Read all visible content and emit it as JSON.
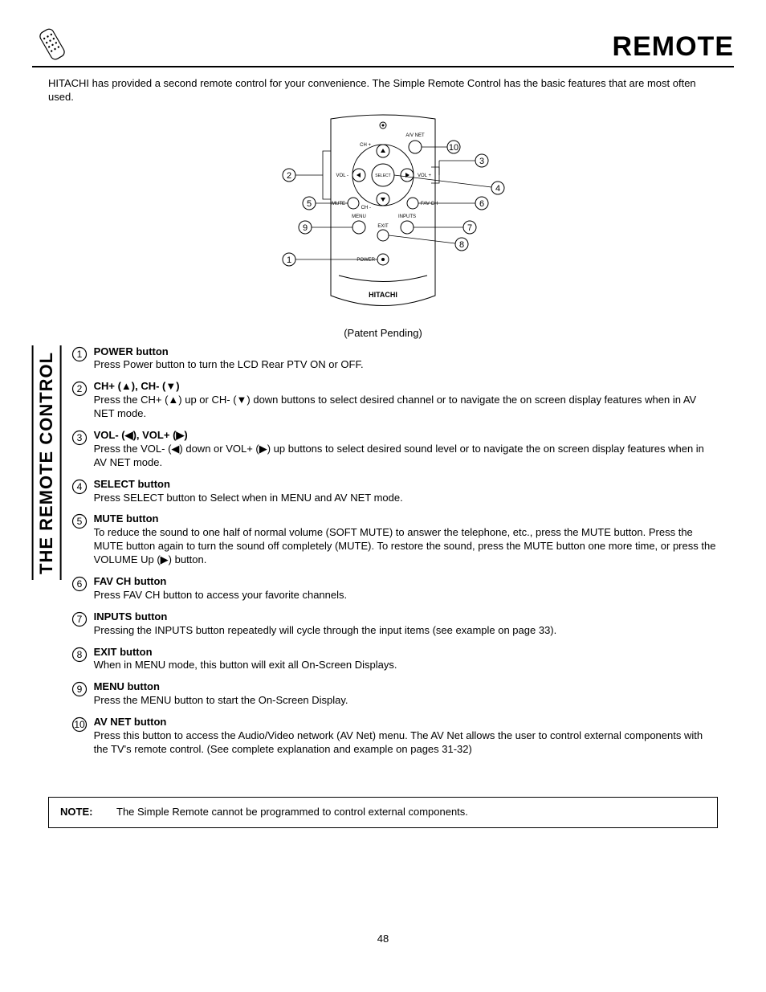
{
  "header": {
    "title": "REMOTE"
  },
  "intro": "HITACHI has provided a second remote control for your convenience.  The Simple Remote Control has the basic features that are most often used.",
  "diagram": {
    "labels": {
      "av_net": "A/V NET",
      "ch_plus": "CH +",
      "ch_minus": "CH -",
      "vol_plus": "VOL +",
      "vol_minus": "VOL -",
      "select": "SELECT",
      "mute": "MUTE",
      "fav_ch": "FAV CH",
      "menu": "MENU",
      "inputs": "INPUTS",
      "exit": "EXIT",
      "power": "POWER",
      "brand": "HITACHI"
    },
    "patent": "(Patent Pending)"
  },
  "side_label": "THE REMOTE CONTROL",
  "items": [
    {
      "num": "1",
      "title": "POWER button",
      "desc": "Press Power button to turn the LCD Rear PTV ON or OFF."
    },
    {
      "num": "2",
      "title": "CH+ (▲), CH- (▼)",
      "desc": "Press the CH+ (▲) up or CH- (▼) down buttons to select desired channel or to navigate the on screen display features when in AV NET mode."
    },
    {
      "num": "3",
      "title": "VOL- (◀), VOL+ (▶)",
      "desc": "Press the VOL- (◀) down or VOL+ (▶) up buttons to select desired sound level or to navigate the on screen display features when in AV NET mode."
    },
    {
      "num": "4",
      "title": "SELECT button",
      "desc": "Press SELECT button to Select when in MENU and AV NET mode."
    },
    {
      "num": "5",
      "title": "MUTE button",
      "desc": "To reduce the sound to one half of normal volume (SOFT MUTE) to answer the telephone, etc., press the MUTE button.  Press the MUTE button again to turn the sound off completely (MUTE).  To restore the sound, press the MUTE button one more time, or press the VOLUME Up (▶) button."
    },
    {
      "num": "6",
      "title": "FAV CH button",
      "desc": "Press FAV CH button to access your favorite channels."
    },
    {
      "num": "7",
      "title": "INPUTS button",
      "desc": "Pressing the INPUTS button repeatedly will cycle through the input items (see example on page 33)."
    },
    {
      "num": "8",
      "title": "EXIT button",
      "desc": "When in MENU mode, this button will exit all On-Screen Displays."
    },
    {
      "num": "9",
      "title": "MENU button",
      "desc": "Press the MENU button to start the On-Screen Display."
    },
    {
      "num": "10",
      "title": "AV NET button",
      "desc": "Press this button to access the Audio/Video network (AV Net) menu.  The AV Net allows the user to control external components with the TV's remote control.  (See complete explanation and example on pages 31-32)"
    }
  ],
  "note": {
    "label": "NOTE:",
    "text": "The Simple Remote cannot be programmed to control external components."
  },
  "page": "48"
}
